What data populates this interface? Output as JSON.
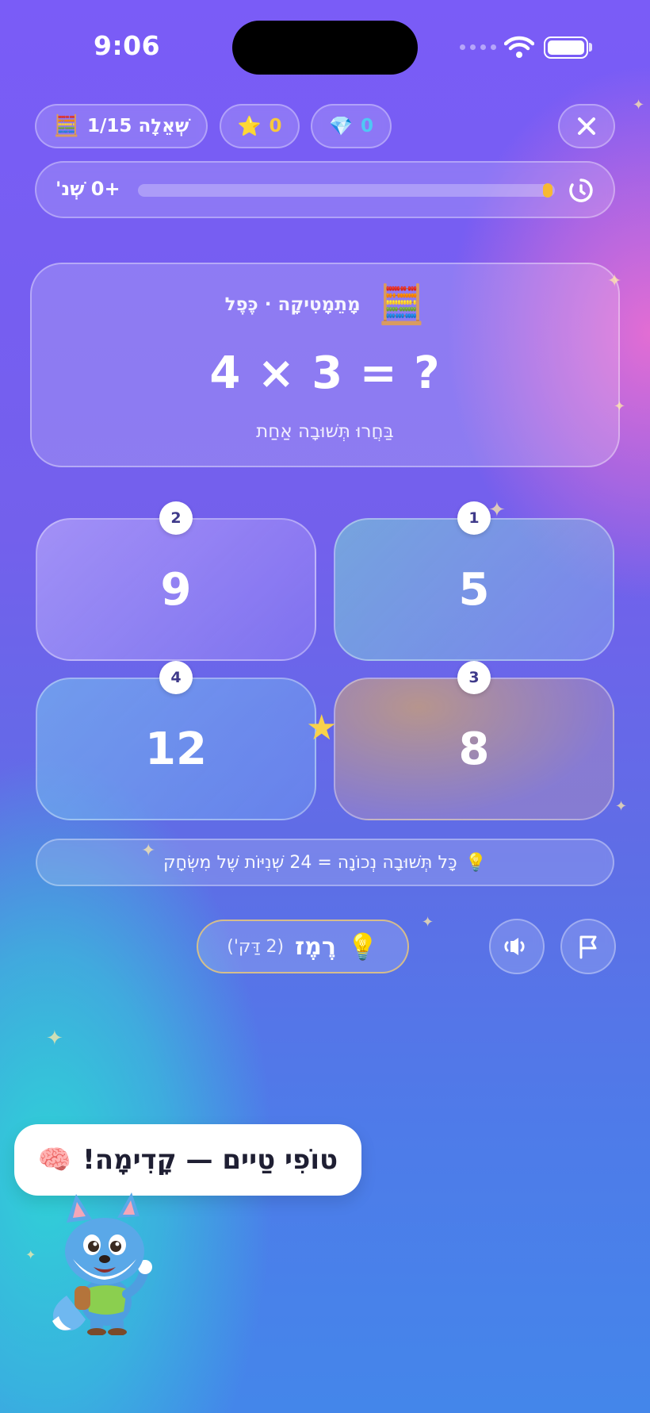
{
  "status_bar": {
    "time": "9:06"
  },
  "header": {
    "gems": "0",
    "stars": "0",
    "question_label": "שְׁאֵלָה 1/15",
    "abacus_emoji": "🧮",
    "star_emoji": "⭐",
    "gem_emoji": "💎"
  },
  "timer": {
    "label": "+0 שְׁנ'",
    "progress": 0.02
  },
  "question": {
    "category": "מָתֵמָטִיקָה · כֶּפֶל",
    "category_emoji": "🧮",
    "equation": "4 × 3 = ?",
    "instruction": "בַּחֲרוּ תְּשׁוּבָה אַחַת"
  },
  "answers": [
    {
      "number": "1",
      "value": "5"
    },
    {
      "number": "2",
      "value": "9"
    },
    {
      "number": "3",
      "value": "8"
    },
    {
      "number": "4",
      "value": "12"
    }
  ],
  "info": {
    "text": "כָּל תְּשׁוּבָה נְכוֹנָה = 24 שְׁנִיּוֹת שֶׁל מִשְׂחָק",
    "emoji": "💡"
  },
  "hint_button": {
    "label": "רֶמֶז",
    "cost": "(2 דַּק')",
    "emoji": "💡"
  },
  "mascot": {
    "speech": "טוֹפִי טַיים — קָדִימָה!",
    "emoji": "🧠"
  },
  "colors": {
    "accent_gold": "#f7b932",
    "badge_text": "#3f3a8a"
  }
}
